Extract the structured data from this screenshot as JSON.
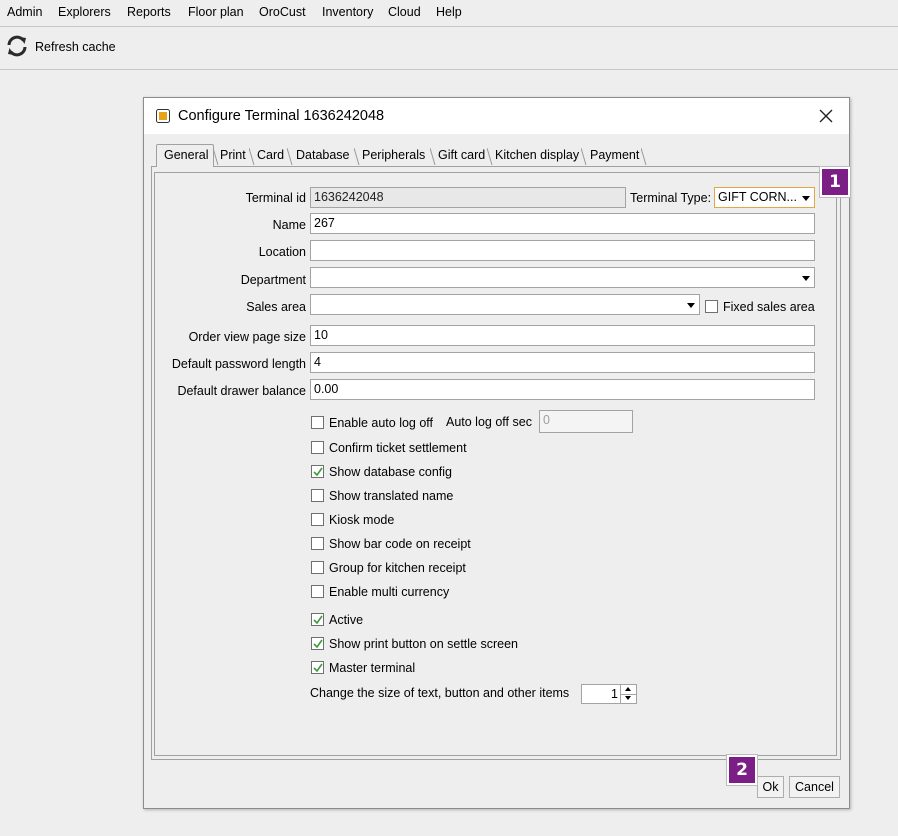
{
  "menubar": {
    "items": [
      "Admin",
      "Explorers",
      "Reports",
      "Floor plan",
      "OroCust",
      "Inventory",
      "Cloud",
      "Help"
    ]
  },
  "toolbar": {
    "refresh_label": "Refresh cache",
    "refresh_icon": "refresh-icon"
  },
  "dialog": {
    "title": "Configure Terminal 1636242048",
    "tabs": [
      "General",
      "Print",
      "Card",
      "Database",
      "Peripherals",
      "Gift card",
      "Kitchen display",
      "Payment"
    ],
    "active_tab": "General",
    "form": {
      "terminal_id_label": "Terminal id",
      "terminal_id_value": "1636242048",
      "terminal_type_label": "Terminal Type:",
      "terminal_type_value": "GIFT CORN...",
      "name_label": "Name",
      "name_value": "267",
      "location_label": "Location",
      "location_value": "",
      "department_label": "Department",
      "department_value": "",
      "sales_area_label": "Sales area",
      "sales_area_value": "",
      "fixed_sales_area_label": "Fixed sales area",
      "order_view_label": "Order view page size",
      "order_view_value": "10",
      "password_length_label": "Default password length",
      "password_length_value": "4",
      "drawer_balance_label": "Default drawer balance",
      "drawer_balance_value": "0.00",
      "auto_log_off_label": "Enable auto log off",
      "auto_log_off_sec_label": "Auto log off sec",
      "auto_log_off_sec_value": "0",
      "confirm_settlement_label": "Confirm ticket settlement",
      "show_db_config_label": "Show database config",
      "show_translated_label": "Show translated name",
      "kiosk_label": "Kiosk mode",
      "bar_code_label": "Show bar code on receipt",
      "group_kitchen_label": "Group for kitchen receipt",
      "multi_currency_label": "Enable multi currency",
      "active_label": "Active",
      "print_button_label": "Show print button on settle screen",
      "master_terminal_label": "Master terminal",
      "size_label": "Change the size of text, button and other items",
      "size_value": "1"
    },
    "ok_label": "Ok",
    "cancel_label": "Cancel"
  },
  "markers": {
    "one": "1",
    "two": "2"
  },
  "colors": {
    "marker": "#7b1f86",
    "check": "#3c9a3c",
    "focus": "#e3a647"
  }
}
